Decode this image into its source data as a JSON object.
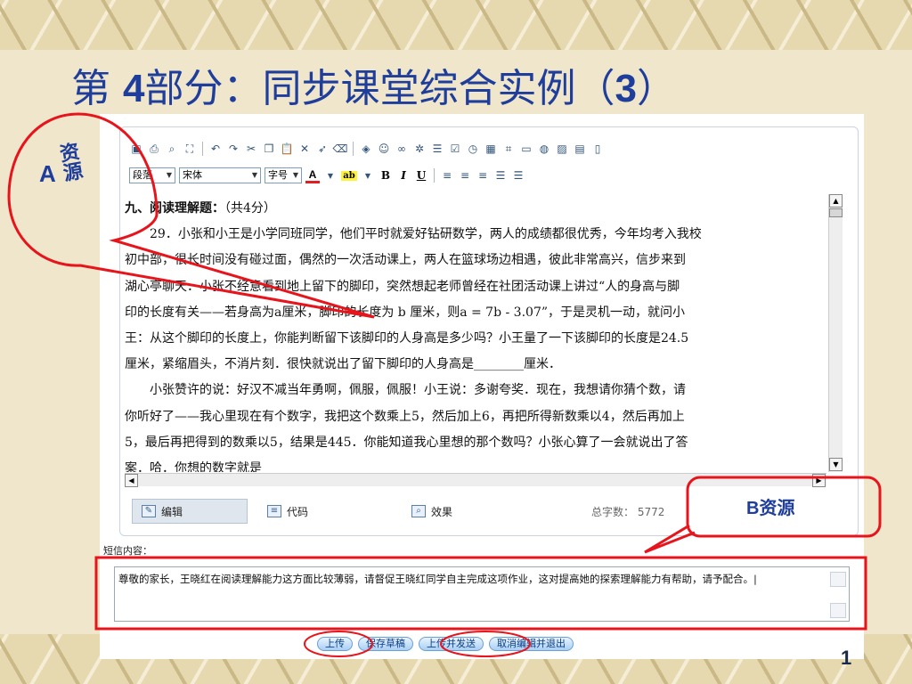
{
  "slide": {
    "title_prefix": "第 ",
    "title_num": "4",
    "title_mid": "部分：同步课堂综合实例（",
    "title_num2": "3",
    "title_suffix": "）",
    "page_number": "1"
  },
  "annotations": {
    "a_letter": "A",
    "a_text": "资源",
    "b_text": "B资源",
    "color": "#e8141c"
  },
  "editor": {
    "toolbar_icons": [
      "save-icon",
      "print-icon",
      "find-icon",
      "fullscreen-icon",
      "undo-icon",
      "redo-icon",
      "cut-icon",
      "copy-icon",
      "paste-icon",
      "delete-icon",
      "cursor-icon",
      "eraser-icon",
      "cube-icon",
      "smiley-icon",
      "link-icon",
      "special-char-icon",
      "hr-icon",
      "checkbox-icon",
      "clock-icon",
      "table-icon",
      "frame-icon",
      "xml-icon",
      "globe-icon",
      "image-icon",
      "toolbox-icon",
      "page-icon"
    ],
    "format_select": "段落",
    "font_select": "宋体",
    "size_select": "字号",
    "font_color_glyph": "A",
    "highlight_glyph": "ab",
    "bold": "B",
    "italic": "I",
    "underline": "U",
    "content": {
      "heading_bold": "九、阅读理解题：",
      "heading_rest": "（共4分）",
      "lines": [
        "　　29．小张和小王是小学同班同学，他们平时就爱好钻研数学，两人的成绩都很优秀，今年均考入我校",
        "初中部，很长时间没有碰过面，偶然的一次活动课上，两人在篮球场边相遇，彼此非常高兴，信步来到",
        "湖心亭聊天．小张不经意看到地上留下的脚印，突然想起老师曾经在社团活动课上讲过“人的身高与脚",
        "印的长度有关——若身高为a厘米，脚印的长度为 b 厘米，则a = 7b - 3.07”，于是灵机一动，就问小",
        "王：从这个脚印的长度上，你能判断留下该脚印的人身高是多少吗？小王量了一下该脚印的长度是24.5",
        "厘米，紧缩眉头，不消片刻．很快就说出了留下脚印的人身高是________厘米．",
        "　　小张赞许的说：好汉不减当年勇啊，佩服，佩服！小王说：多谢夸奖．现在，我想请你猜个数，请",
        "你听好了——我心里现在有个数字，我把这个数乘上5，然后加上6，再把所得新数乘以4，然后再加上",
        "5，最后再把得到的数乘以5，结果是445．你能知道我心里想的那个数吗？小张心算了一会就说出了答",
        "案．哈．你想的数字就是"
      ]
    },
    "modes": {
      "edit": "编辑",
      "code": "代码",
      "preview": "效果"
    },
    "char_count_label": "总字数：",
    "char_count": "5772"
  },
  "sms": {
    "label": "短信内容：",
    "text": "尊敬的家长，王晓红在阅读理解能力这方面比较薄弱，请督促王晓红同学自主完成这项作业，这对提高她的探索理解能力有帮助，请予配合。|"
  },
  "buttons": {
    "upload": "上传",
    "save_draft": "保存草稿",
    "upload_send": "上传并发送",
    "cancel_exit": "取消编辑并退出"
  }
}
